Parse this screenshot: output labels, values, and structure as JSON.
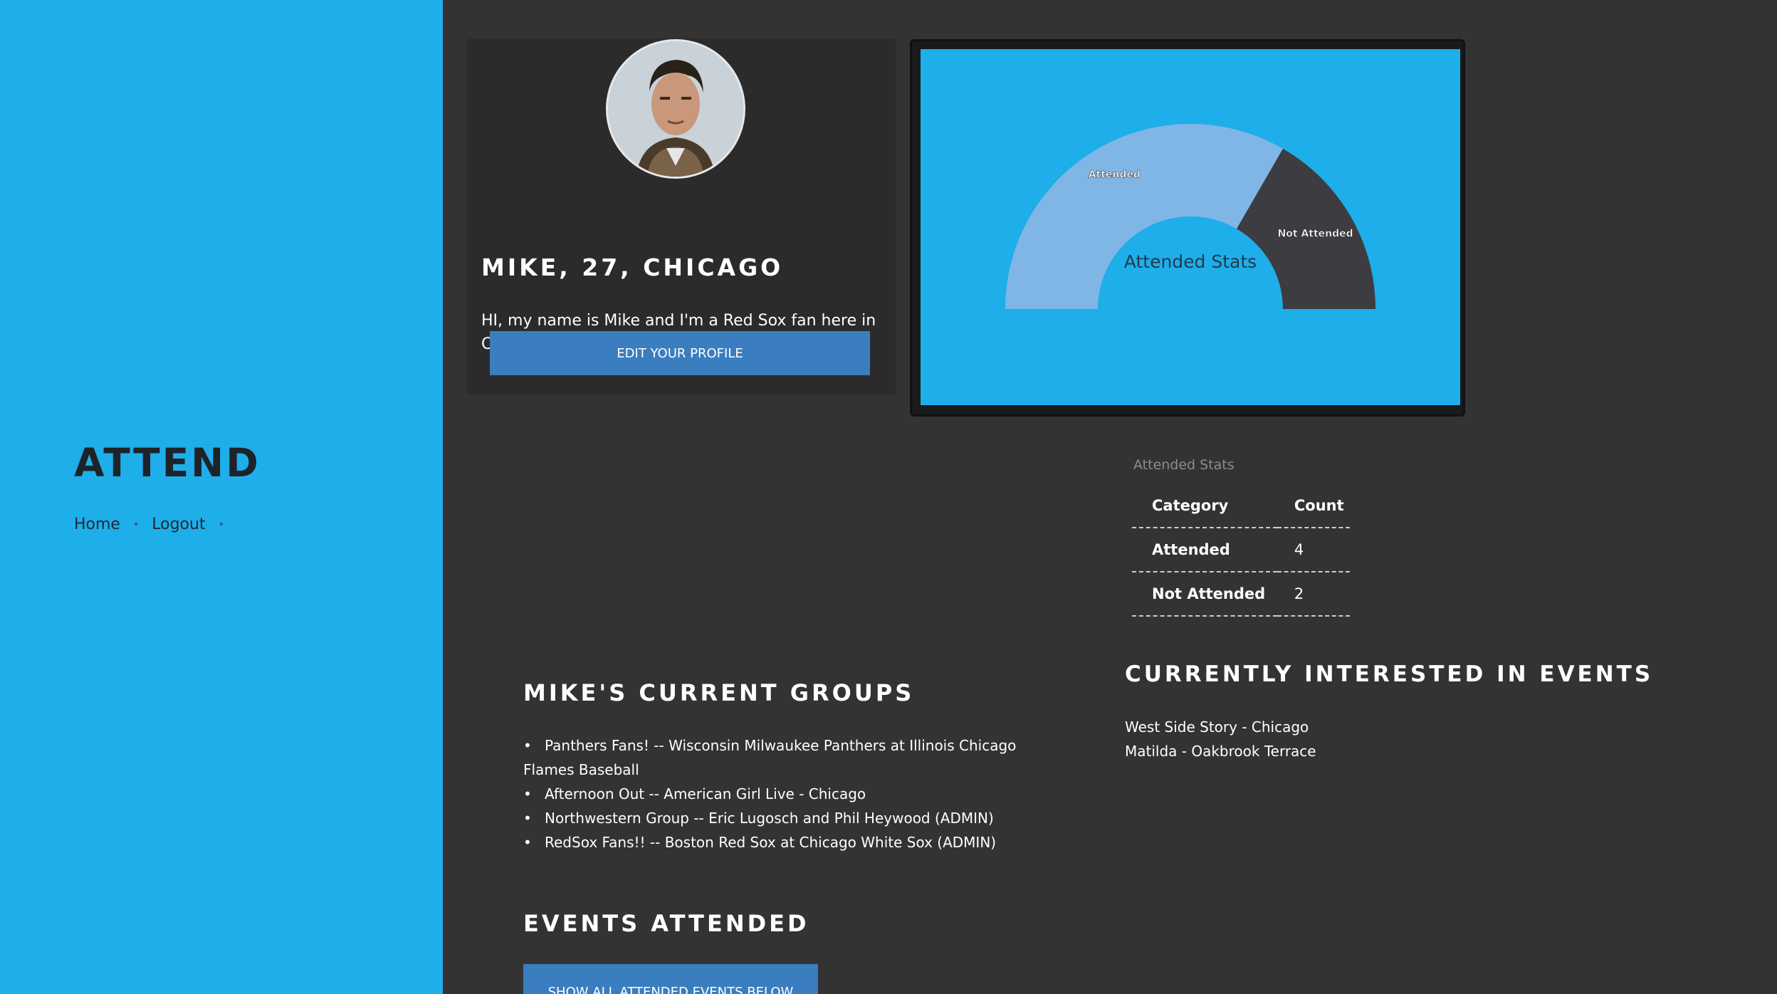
{
  "sidebar": {
    "brand": "ATTEND",
    "nav": [
      {
        "label": "Home"
      },
      {
        "label": "Logout"
      }
    ]
  },
  "profile": {
    "name_line": "MIKE, 27, CHICAGO",
    "bio": "HI, my name is Mike and I'm a Red Sox fan here in Chicago! Let's link up and go to a game!",
    "edit_button": "EDIT YOUR PROFILE"
  },
  "colors": {
    "sidebar_bg": "#1eaeea",
    "main_bg": "#333333",
    "button_bg": "#3a7ebf",
    "attended_slice": "#7fb6e6",
    "not_attended_slice": "#3d3c40"
  },
  "chart_data": {
    "type": "pie",
    "variant": "half-donut",
    "center_label": "Attended Stats",
    "categories": [
      "Attended",
      "Not Attended"
    ],
    "values": [
      4,
      2
    ],
    "slice_colors": [
      "#7fb6e6",
      "#3d3c40"
    ]
  },
  "stats_table": {
    "caption": "Attended Stats",
    "headers": [
      "Category",
      "Count"
    ],
    "rows": [
      {
        "category": "Attended",
        "count": "4"
      },
      {
        "category": "Not Attended",
        "count": "2"
      }
    ]
  },
  "groups": {
    "title": "MIKE'S CURRENT GROUPS",
    "items": [
      "Panthers Fans! -- Wisconsin Milwaukee Panthers at Illinois Chicago Flames Baseball",
      "Afternoon Out -- American Girl Live - Chicago",
      "Northwestern Group -- Eric Lugosch and Phil Heywood (ADMIN)",
      "RedSox Fans!! -- Boston Red Sox at Chicago White Sox (ADMIN)"
    ]
  },
  "interested": {
    "title": "CURRENTLY INTERESTED IN EVENTS",
    "items": [
      "West Side Story - Chicago",
      "Matilda - Oakbrook Terrace"
    ]
  },
  "events_attended": {
    "title": "EVENTS ATTENDED",
    "button": "SHOW ALL ATTENDED EVENTS BELOW"
  }
}
